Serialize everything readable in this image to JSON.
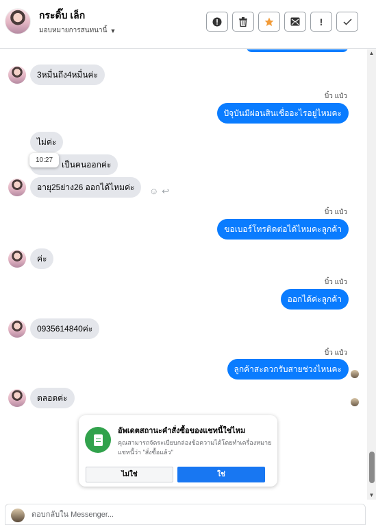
{
  "header": {
    "contact_name": "กระดิ๊บ เล็ก",
    "assign_label": "มอบหมายการสนทนานี้",
    "toolbar": [
      {
        "icon": "alert-circle-icon",
        "glyph": "!"
      },
      {
        "icon": "trash-icon",
        "glyph": "🗑"
      },
      {
        "icon": "star-icon",
        "glyph": "★"
      },
      {
        "icon": "mail-spam-icon",
        "glyph": "✉"
      },
      {
        "icon": "exclamation-icon",
        "glyph": "!"
      },
      {
        "icon": "check-icon",
        "glyph": "✓"
      }
    ]
  },
  "messages": {
    "m1": "3หมื่นถึง4หมื่นค่ะ",
    "sender1": "บิ๋ว แป๋ว",
    "m2": "ปัจุบันมีผ่อนสินเชื่ออะไรอยู่ไหมคะ",
    "m3": "ไม่ค่ะ",
    "m4": "เป็นคนออกค่ะ",
    "tooltip_time": "10:27",
    "m5": "อายุ25ย่าง26 ออกได้ไหมค่ะ",
    "sender2": "บิ๋ว แป๋ว",
    "m6": "ขอเบอร์โทรติดต่อได้ไหมคะลูกค้า",
    "m7": "ค่ะ",
    "sender3": "บิ๋ว แป๋ว",
    "m8": "ออกได้ค่ะลูกค้า",
    "m9": "0935614840ค่ะ",
    "sender4": "บิ๋ว แป๋ว",
    "m10": "ลูกค้าสะดวกรับสายช่วงไหนคะ",
    "m11": "ตลอดค่ะ"
  },
  "notice": {
    "title": "อัพเดตสถานะคำสั่งซื้อของแชทนี้ใช่ไหม",
    "description": "คุณสามารถจัดระเบียบกล่องข้อความได้โดยทำเครื่องหมายแชทนี้ว่า \"สั่งซื้อแล้ว\"",
    "no_label": "ไม่ใช่",
    "yes_label": "ใช่"
  },
  "composer": {
    "placeholder": "ตอบกลับใน Messenger..."
  },
  "colors": {
    "outgoing_bubble": "#0a7cff",
    "incoming_bubble": "#e4e6eb",
    "primary_button": "#1877f2",
    "notice_icon": "#31a24c"
  }
}
